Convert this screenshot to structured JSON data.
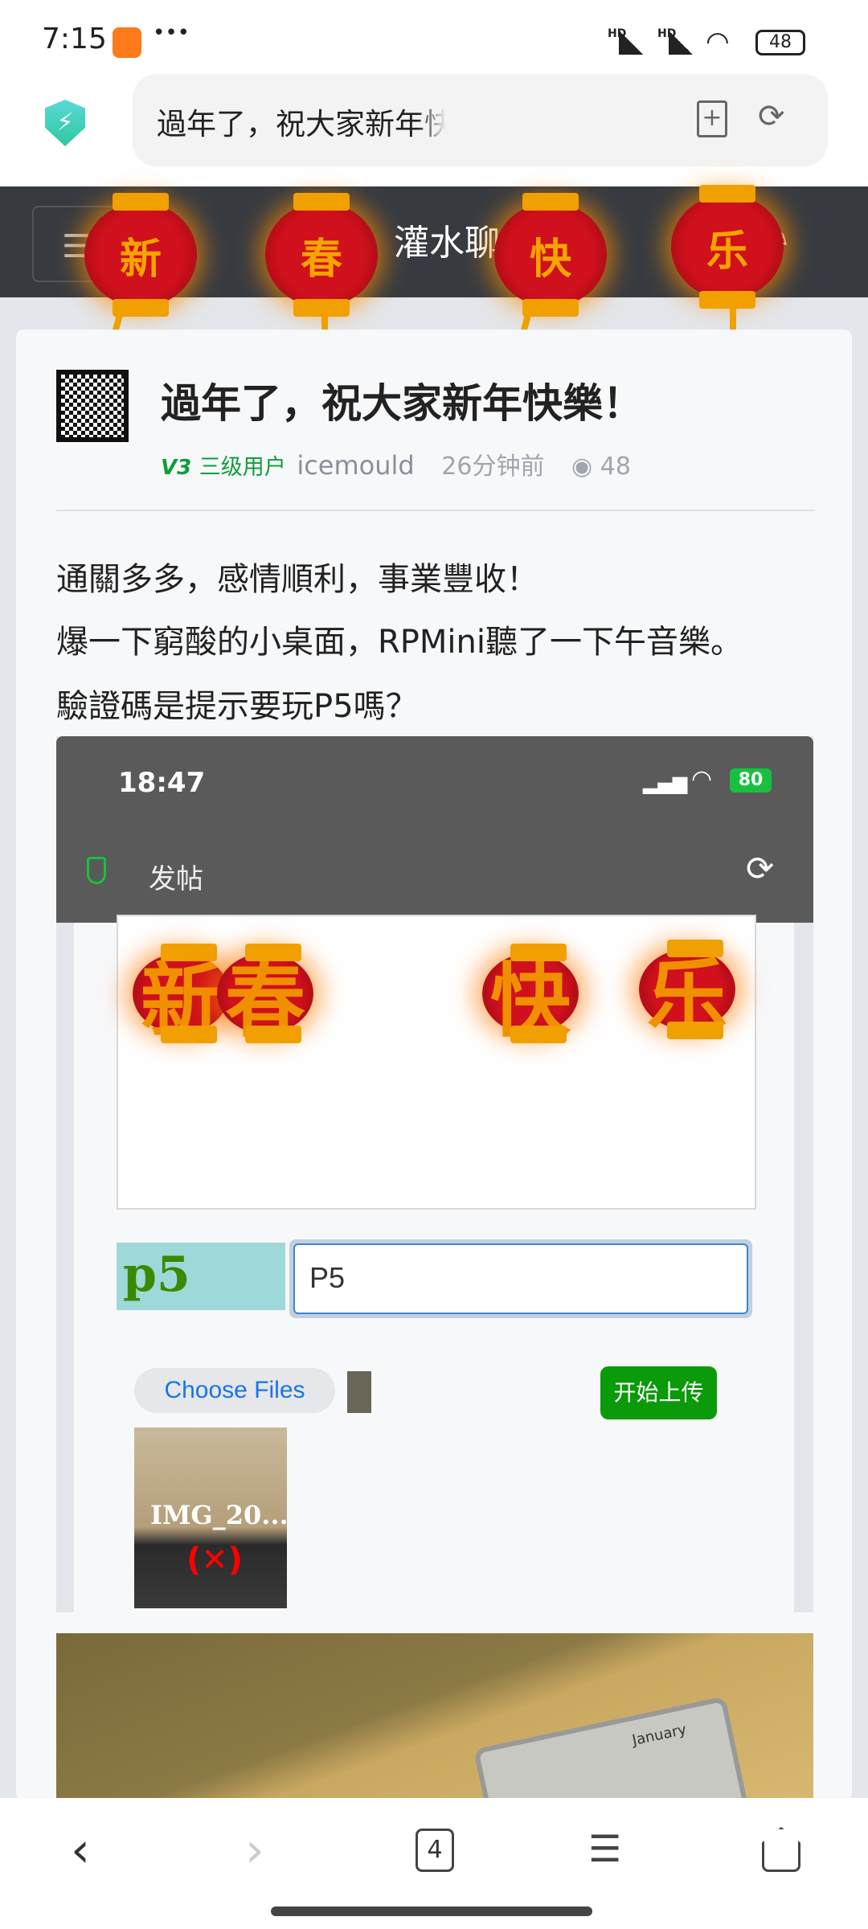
{
  "status_bar": {
    "time": "7:15",
    "dots": "•••",
    "battery": "48",
    "signal1": "HD",
    "signal2": "HD"
  },
  "url_bar": {
    "title": "過年了，祝大家新年快樂！-灌水"
  },
  "site_header": {
    "title": "灌水聊天",
    "lanterns": [
      "新",
      "春",
      "快",
      "乐"
    ]
  },
  "post": {
    "title": "過年了，祝大家新年快樂！",
    "level_badge": "V3",
    "level_label": "三级用户",
    "author": "icemould",
    "time": "26分钟前",
    "views": "48",
    "body": [
      "通關多多，感情順利，事業豐收！",
      "爆一下窮酸的小桌面，RPMini聽了一下午音樂。",
      "驗證碼是提示要玩P5嗎？"
    ]
  },
  "embedded_screenshot": {
    "time": "18:47",
    "battery": "80",
    "page_title": "发帖",
    "lanterns": [
      "新",
      "春",
      "快",
      "乐"
    ],
    "captcha_text": "p5",
    "captcha_input": "P5",
    "choose_files": "Choose Files",
    "upload_button": "开始上传",
    "preview_name": "IMG_20...",
    "preview_remove": "(✕)"
  },
  "photo": {
    "calendar_month": "January"
  },
  "bottom_nav": {
    "tabs_count": "4"
  },
  "colors": {
    "header_bg": "#373b40",
    "accent_green": "#109d3b",
    "upload_green": "#0a9a0a",
    "link_blue": "#1a73e8"
  }
}
